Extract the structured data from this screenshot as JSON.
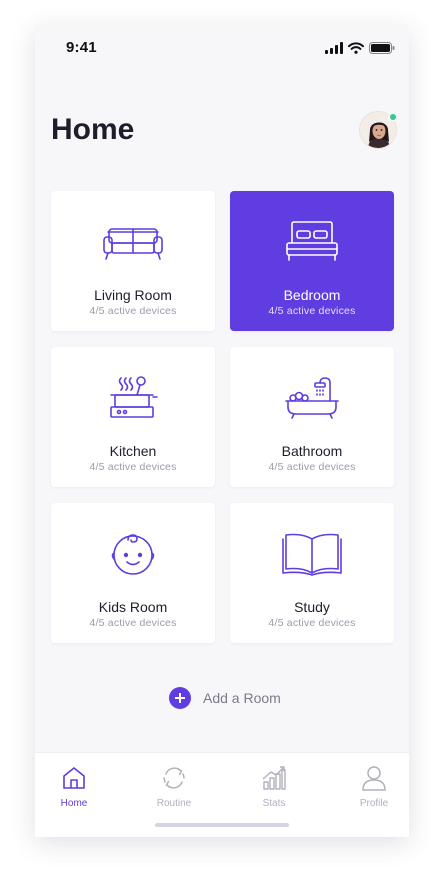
{
  "status_bar": {
    "time": "9:41",
    "icons": [
      "signal-icon",
      "wifi-icon",
      "battery-icon"
    ]
  },
  "header": {
    "title": "Home",
    "avatar": {
      "icon": "user-avatar",
      "online": true,
      "status_color": "#2ecc8f"
    }
  },
  "colors": {
    "accent": "#5f3de0",
    "background": "#f7f7fa",
    "card": "#ffffff",
    "text_primary": "#1f1d2b",
    "text_secondary": "#9c9bab",
    "inactive_tab": "#b1b0bd"
  },
  "rooms": [
    {
      "name": "Living Room",
      "status": "4/5 active devices",
      "icon": "sofa-icon",
      "selected": false
    },
    {
      "name": "Bedroom",
      "status": "4/5 active devices",
      "icon": "bed-icon",
      "selected": true
    },
    {
      "name": "Kitchen",
      "status": "4/5 active devices",
      "icon": "cooking-pot-icon",
      "selected": false
    },
    {
      "name": "Bathroom",
      "status": "4/5 active devices",
      "icon": "bathtub-icon",
      "selected": false
    },
    {
      "name": "Kids Room",
      "status": "4/5 active devices",
      "icon": "baby-face-icon",
      "selected": false
    },
    {
      "name": "Study",
      "status": "4/5 active devices",
      "icon": "open-book-icon",
      "selected": false
    }
  ],
  "add_room": {
    "label": "Add a Room",
    "icon": "plus-circle-icon"
  },
  "tabs": [
    {
      "label": "Home",
      "icon": "house-icon",
      "active": true
    },
    {
      "label": "Routine",
      "icon": "refresh-icon",
      "active": false
    },
    {
      "label": "Stats",
      "icon": "bar-chart-icon",
      "active": false
    },
    {
      "label": "Profile",
      "icon": "person-icon",
      "active": false
    }
  ]
}
